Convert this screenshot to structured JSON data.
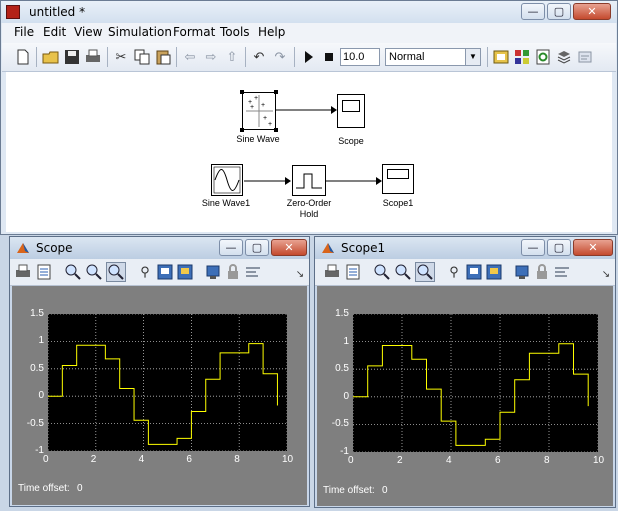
{
  "main_window": {
    "title": "untitled *",
    "menus": [
      "File",
      "Edit",
      "View",
      "Simulation",
      "Format",
      "Tools",
      "Help"
    ],
    "stop_time": "10.0",
    "sim_mode": "Normal",
    "blocks": {
      "sine_wave": "Sine Wave",
      "scope": "Scope",
      "sine_wave1": "Sine Wave1",
      "zoh_line1": "Zero-Order",
      "zoh_line2": "Hold",
      "scope1": "Scope1"
    }
  },
  "scope_windows": [
    {
      "title": "Scope",
      "time_offset_label": "Time offset:",
      "time_offset_value": "0"
    },
    {
      "title": "Scope1",
      "time_offset_label": "Time offset:",
      "time_offset_value": "0"
    }
  ],
  "window_buttons": {
    "minimize": "—",
    "maximize": "▢",
    "close": "✕"
  },
  "chart_data": [
    {
      "type": "line",
      "title": "",
      "xlabel": "",
      "ylabel": "",
      "xlim": [
        0,
        10
      ],
      "ylim": [
        -1,
        1.5
      ],
      "grid": true,
      "line_color": "#ffff00",
      "xticks": [
        "0",
        "2",
        "4",
        "6",
        "8",
        "10"
      ],
      "yticks": [
        "1.5",
        "1",
        "0.5",
        "0",
        "-0.5",
        "-1"
      ],
      "x": [
        0,
        0.6,
        0.6,
        1.2,
        1.2,
        2.4,
        2.4,
        3.0,
        3.0,
        3.6,
        3.6,
        4.2,
        4.2,
        5.4,
        5.4,
        6.0,
        6.0,
        6.6,
        6.6,
        7.2,
        7.2,
        8.4,
        8.4,
        9.0,
        9.0,
        9.6,
        9.6
      ],
      "y": [
        0,
        0,
        0.56,
        0.56,
        0.93,
        0.93,
        0.68,
        0.68,
        0.14,
        0.14,
        -0.44,
        -0.44,
        -0.88,
        -0.88,
        -0.77,
        -0.77,
        -0.28,
        -0.28,
        0.31,
        0.31,
        0.79,
        0.79,
        0.96,
        0.96,
        0.41,
        0.41,
        -0.17
      ]
    },
    {
      "type": "line",
      "title": "",
      "xlabel": "",
      "ylabel": "",
      "xlim": [
        0,
        10
      ],
      "ylim": [
        -1,
        1.5
      ],
      "grid": true,
      "line_color": "#ffff00",
      "xticks": [
        "0",
        "2",
        "4",
        "6",
        "8",
        "10"
      ],
      "yticks": [
        "1.5",
        "1",
        "0.5",
        "0",
        "-0.5",
        "-1"
      ],
      "x": [
        0,
        0.6,
        0.6,
        1.2,
        1.2,
        2.4,
        2.4,
        3.0,
        3.0,
        3.6,
        3.6,
        4.2,
        4.2,
        5.4,
        5.4,
        6.0,
        6.0,
        6.6,
        6.6,
        7.2,
        7.2,
        8.4,
        8.4,
        9.0,
        9.0,
        9.6,
        9.6
      ],
      "y": [
        0,
        0,
        0.56,
        0.56,
        0.93,
        0.93,
        0.68,
        0.68,
        0.14,
        0.14,
        -0.44,
        -0.44,
        -0.88,
        -0.88,
        -0.77,
        -0.77,
        -0.28,
        -0.28,
        0.31,
        0.31,
        0.79,
        0.79,
        0.96,
        0.96,
        0.41,
        0.41,
        -0.17
      ]
    }
  ]
}
